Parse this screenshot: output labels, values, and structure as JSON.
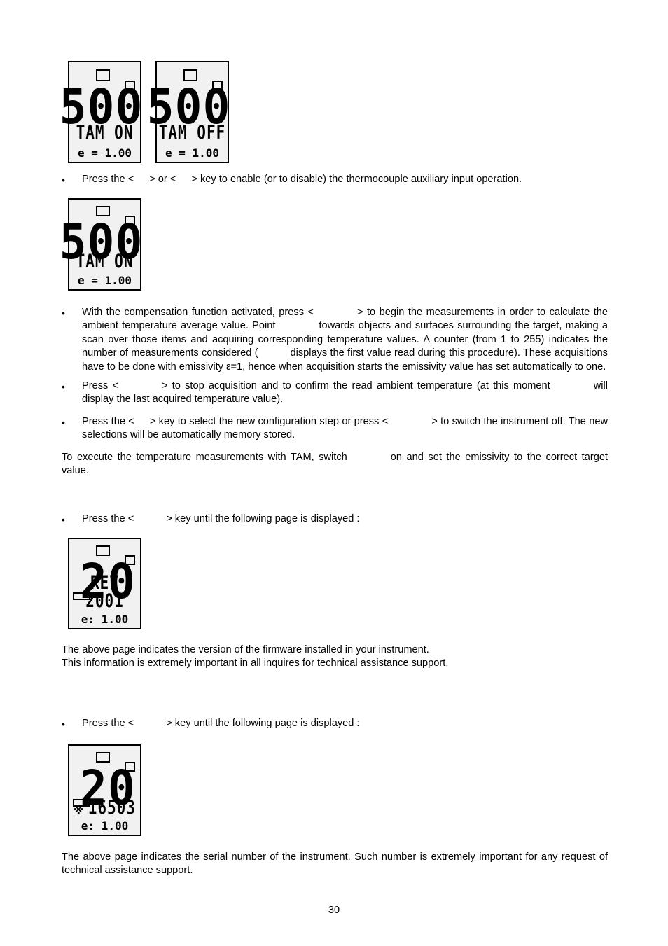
{
  "document": {
    "page_number": "30"
  },
  "displays": {
    "tam_on_small": {
      "big_value": "500",
      "mode_text": "TAM ON",
      "emissivity": "e = 1.00",
      "indicators": [
        "top-center-box",
        "top-right-box"
      ]
    },
    "tam_off_small": {
      "big_value": "500",
      "mode_text": "TAM OFF",
      "emissivity": "e = 1.00",
      "indicators": [
        "top-center-box",
        "top-right-box"
      ]
    },
    "tam_on_large": {
      "big_value": "500",
      "mode_text": "TAM ON",
      "emissivity": "e = 1.00",
      "indicators": [
        "top-center-box",
        "top-right-box"
      ]
    },
    "firmware_rev": {
      "big_value": "20",
      "mode_text": "REV 2001",
      "emissivity": "e: 1.00",
      "indicators": [
        "top-center-box",
        "top-right-box",
        "left-bar"
      ]
    },
    "serial_number": {
      "big_value": "20",
      "mode_text": "16503",
      "emissivity": "e: 1.00",
      "icon": "snowflake-icon",
      "icon_glyph": "※",
      "indicators": [
        "top-center-box",
        "top-right-box",
        "left-bar"
      ]
    }
  },
  "content": {
    "bullet_marker": "•",
    "b1_part1": "Press the <",
    "b1_part2": "> or <",
    "b1_part3": "> key to enable (or to disable) the thermocouple auxiliary input operation.",
    "b2_part1": "With the compensation function activated, press <",
    "b2_part2": "> to begin the measurements in order to calculate the ambient temperature average value. Point",
    "b2_part3": "towards objects and surfaces surrounding the target, making a scan over those items and acquiring corresponding temperature values. A counter (from 1 to 255) indicates the number of measurements considered (",
    "b2_part4": "displays the first value read during this procedure). These acquisitions have to be done with emissivity ε=1, hence when acquisition starts the emissivity value has set automatically to one.",
    "b3_part1": "Press <",
    "b3_part2": "> to stop acquisition and to confirm the read ambient temperature (at this moment",
    "b3_part3": "will display the last acquired temperature value).",
    "b4_part1": "Press the <",
    "b4_part2": "> key to select the new configuration step or press <",
    "b4_part3": "> to switch the instrument off. The new selections will be automatically memory stored.",
    "p1_part1": "To execute the temperature measurements with TAM, switch",
    "p1_part2": "on and set the emissivity to the correct target value.",
    "b5_part1": "Press the <",
    "b5_part2": "> key until the following page is displayed :",
    "p2_line1": "The above page indicates the version of the firmware installed in your instrument.",
    "p2_line2": "This information is extremely important in all inquires for technical assistance support.",
    "b6_part1": "Press the <",
    "b6_part2": "> key until the following page is displayed :",
    "p3_text": "The above page indicates the serial number of the instrument. Such number is extremely important for any request of technical assistance support."
  },
  "colors": {
    "lcd_background": "#f1f1f1",
    "lcd_border": "#000000",
    "text": "#000000",
    "page_background": "#ffffff"
  }
}
